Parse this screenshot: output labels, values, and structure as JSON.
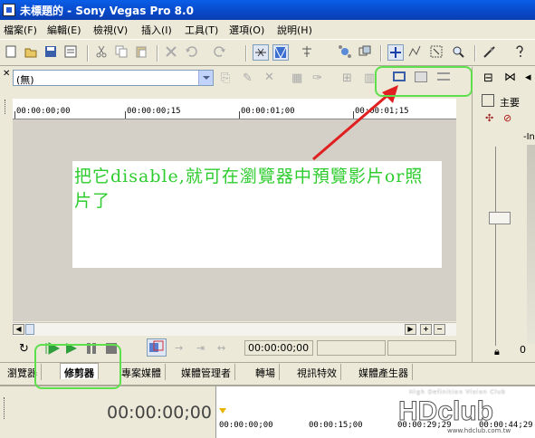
{
  "window": {
    "title": "未標題的 - Sony Vegas Pro 8.0"
  },
  "menu": [
    "檔案(F)",
    "編輯(E)",
    "檢視(V)",
    "插入(I)",
    "工具(T)",
    "選項(O)",
    "說明(H)"
  ],
  "trimmer": {
    "media_selector": "(無)",
    "ruler_labels": [
      "00:00:00;00",
      "00:00:00;15",
      "00:00:01;00",
      "00:00:01;15"
    ],
    "timecode": "00:00:00;00"
  },
  "annotation": {
    "text": "把它disable,就可在瀏覽器中預覽影片or照片了",
    "color": "#2ecc2e"
  },
  "tabs": [
    "瀏覽器",
    "修剪器",
    "專案媒體",
    "媒體管理者",
    "轉場",
    "視訊特效",
    "媒體產生器"
  ],
  "active_tab": "修剪器",
  "timeline": {
    "timecode": "00:00:00;00",
    "ruler_labels": [
      "00:00:00;00",
      "00:00:15;00",
      "00:00:29;29",
      "00:00:44;29"
    ]
  },
  "mixer": {
    "label": "主要",
    "level_label": "-In"
  },
  "watermark": {
    "tagline": "High Definition Vision Club",
    "logo": "HDclub",
    "url": "www.hdclub.com.tw"
  },
  "colors": {
    "titlebar": "#0848c8",
    "highlight": "#5ee04d",
    "arrow": "#e02020"
  }
}
